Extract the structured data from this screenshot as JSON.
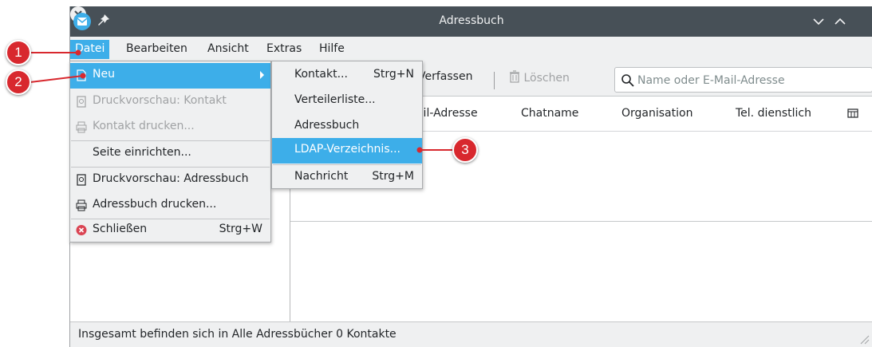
{
  "window": {
    "title": "Adressbuch"
  },
  "menubar": {
    "items": [
      {
        "id": "datei",
        "label": "Datei"
      },
      {
        "id": "bearbeiten",
        "label": "Bearbeiten"
      },
      {
        "id": "ansicht",
        "label": "Ansicht"
      },
      {
        "id": "extras",
        "label": "Extras"
      },
      {
        "id": "hilfe",
        "label": "Hilfe"
      }
    ]
  },
  "toolbar": {
    "compose_label": "Verfassen",
    "delete_label": "Löschen"
  },
  "search": {
    "placeholder": "Name oder E-Mail-Adresse",
    "value": ""
  },
  "columns": [
    "E-Mail-Adresse",
    "Chatname",
    "Organisation",
    "Tel. dienstlich"
  ],
  "file_menu": {
    "items": [
      {
        "label": "Neu",
        "highlighted": true,
        "has_submenu": true
      },
      {
        "label": "Druckvorschau: Kontakt",
        "disabled": true
      },
      {
        "label": "Kontakt drucken...",
        "disabled": true
      },
      {
        "label": "Seite einrichten..."
      },
      {
        "label": "Druckvorschau: Adressbuch"
      },
      {
        "label": "Adressbuch drucken..."
      },
      {
        "label": "Schließen",
        "shortcut": "Strg+W"
      }
    ]
  },
  "new_submenu": {
    "items": [
      {
        "label": "Kontakt...",
        "shortcut": "Strg+N"
      },
      {
        "label": "Verteilerliste..."
      },
      {
        "label": "Adressbuch"
      },
      {
        "label": "LDAP-Verzeichnis...",
        "highlighted": true
      },
      {
        "label": "Nachricht",
        "shortcut": "Strg+M"
      }
    ]
  },
  "status": {
    "text": "Insgesamt befinden sich in Alle Adressbücher 0 Kontakte"
  },
  "callouts": [
    "1",
    "2",
    "3"
  ],
  "colors": {
    "accent": "#3daee9",
    "titlebar": "#475057",
    "callout": "#d8282e",
    "close": "#da4453"
  },
  "icons": {
    "app": "addressbook-app-icon",
    "pin": "pin-icon",
    "minimize": "chevron-down-icon",
    "maximize": "chevron-up-icon",
    "close": "close-icon",
    "search": "search-icon",
    "delete": "trash-icon",
    "print": "printer-icon",
    "preview": "print-preview-icon",
    "new": "new-document-icon",
    "quit": "quit-icon",
    "column_picker": "column-picker-icon"
  }
}
